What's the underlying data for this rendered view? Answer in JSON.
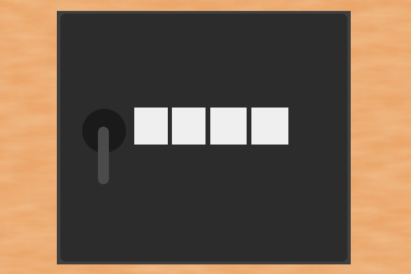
{
  "scene": {
    "wall_color": "#eba66a",
    "door_color": "#2c2c2c",
    "frame_color": "#3f3f3f"
  },
  "keypad": {
    "slot_color": "#efefef",
    "digits": [
      "",
      "",
      "",
      ""
    ]
  },
  "handle": {
    "icon": "door-handle-icon"
  }
}
